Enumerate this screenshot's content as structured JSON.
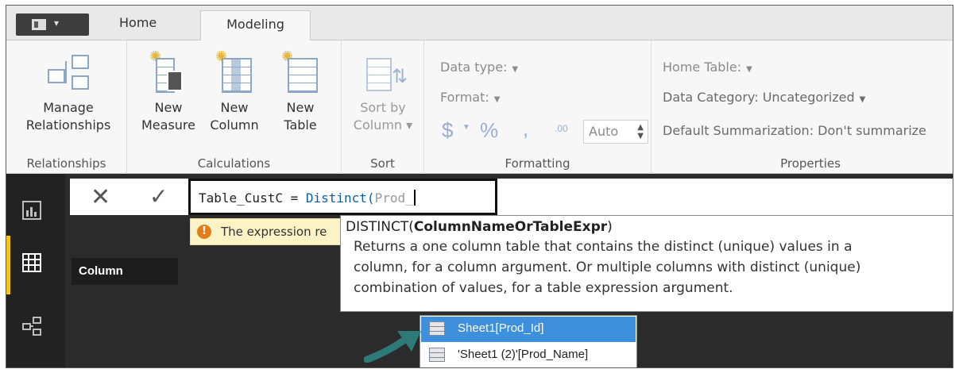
{
  "tabs": {
    "file_caret": "▾",
    "home": "Home",
    "modeling": "Modeling"
  },
  "ribbon": {
    "relationships": {
      "manage": [
        "Manage",
        "Relationships"
      ],
      "group": "Relationships"
    },
    "calculations": {
      "new_measure": [
        "New",
        "Measure"
      ],
      "new_column": [
        "New",
        "Column"
      ],
      "new_table": [
        "New",
        "Table"
      ],
      "group": "Calculations"
    },
    "sort": {
      "sort_by": [
        "Sort by",
        "Column ▾"
      ],
      "group": "Sort"
    },
    "formatting": {
      "data_type": "Data type:",
      "format": "Format:",
      "currency": "$",
      "percent": "%",
      "comma": ",",
      "decimal": ".00",
      "auto": "Auto",
      "group": "Formatting"
    },
    "properties": {
      "home_table": "Home Table:",
      "data_category": "Data Category: Uncategorized",
      "default_summarization": "Default Summarization: Don't summarize",
      "group": "Properties"
    }
  },
  "formula": {
    "prefix": "Table_CustC = ",
    "function": "Distinct(",
    "typed": "Prod_"
  },
  "warning": {
    "text": "The expression re"
  },
  "column_tooltip": "Column",
  "intellisense": {
    "signature_fn": "DISTINCT(",
    "signature_arg": "ColumnNameOrTableExpr",
    "signature_end": ")",
    "desc_lines": [
      "Returns a one column table that contains the distinct (unique) values in a",
      "column, for a column argument. Or multiple columns with distinct (unique)",
      "combination of values, for a table expression argument."
    ]
  },
  "autocomplete": [
    {
      "label": "Sheet1[Prod_Id]",
      "selected": true
    },
    {
      "label": "'Sheet1 (2)'[Prod_Name]",
      "selected": false
    }
  ],
  "colors": {
    "accent_yellow": "#f2c811",
    "selection_blue": "#3e8fdc",
    "arrow_teal": "#2d7a78"
  }
}
